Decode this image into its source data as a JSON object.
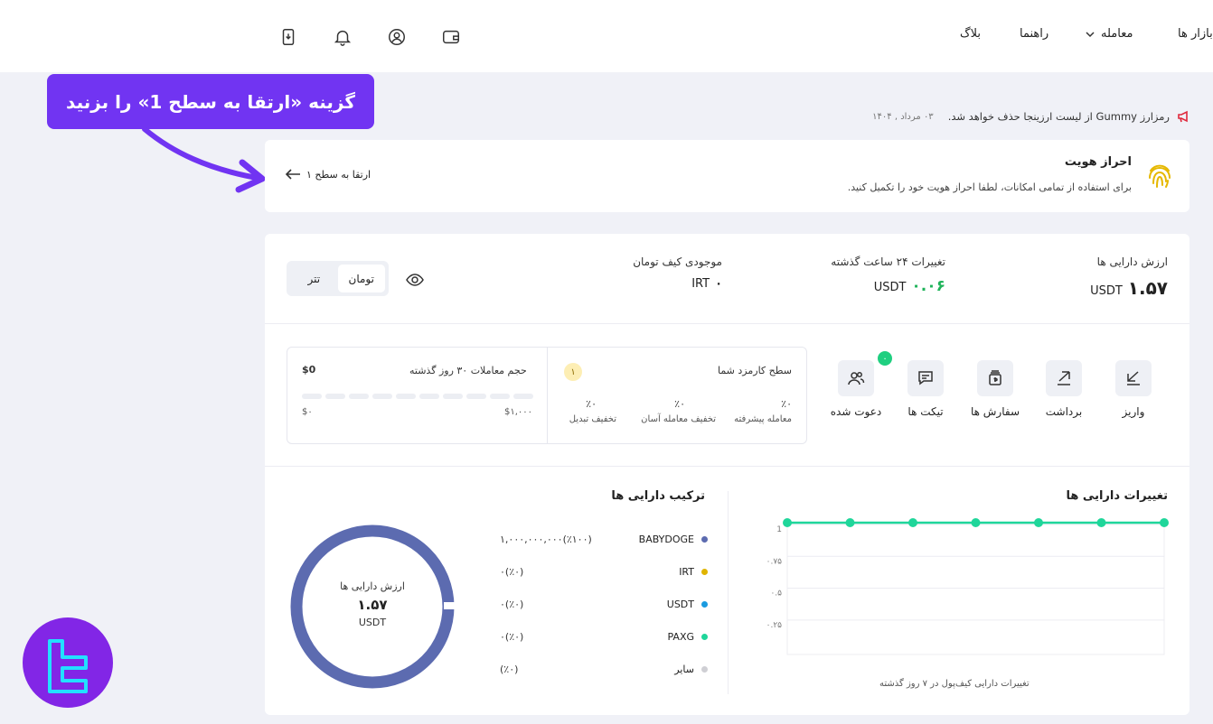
{
  "nav": {
    "markets": "بازار ها",
    "trade": "معامله",
    "guide": "راهنما",
    "blog": "بلاگ"
  },
  "announcement": {
    "text": "رمزارز Gummy از لیست ارزینجا حذف خواهد شد.",
    "date": "۰۳ مرداد , ۱۴۰۴"
  },
  "callout": {
    "text": "گزینه «ارتقا به سطح 1» را بزنید"
  },
  "kyc": {
    "title": "احراز هویت",
    "description": "برای استفاده از تمامی امکانات، لطفا احراز هویت خود را تکمیل کنید.",
    "upgrade_label": "ارتقا به سطح ۱"
  },
  "summary": {
    "asset_value_label": "ارزش دارایی ها",
    "asset_value": "۱.۵۷",
    "asset_unit": "USDT",
    "change_label": "تغییرات ۲۴ ساعت گذشته",
    "change_value": "۰.۰۶",
    "change_unit": "USDT",
    "wallet_label": "موجودی کیف تومان",
    "wallet_value": "۰",
    "wallet_unit": "IRT",
    "toggle_toman": "تومان",
    "toggle_tether": "تتر"
  },
  "quick_actions": {
    "deposit": "واریز",
    "withdraw": "برداشت",
    "orders": "سفارش ها",
    "tickets": "تیکت ها",
    "invited": "دعوت شده",
    "invited_count": "۰"
  },
  "fee": {
    "level_label": "سطح کارمزد شما",
    "level": "۱",
    "advanced_pct": "٪۰",
    "advanced_label": "معامله پیشرفته",
    "easy_pct": "٪۰",
    "easy_label": "تخفیف معامله آسان",
    "convert_pct": "٪۰",
    "convert_label": "تخفیف تبدیل",
    "volume_label": "حجم معاملات ۳۰ روز گذشته",
    "volume_value": "$0",
    "volume_max": "$۱,۰۰۰",
    "volume_min": "$۰",
    "volume_progress": 0
  },
  "asset_changes": {
    "title": "تغییرات دارایی ها",
    "caption": "تغییرات دارایی کیف‌پول در ۷ روز گذشته",
    "y_ticks": [
      "1",
      "۰.۷۵",
      "۰.۵",
      "۰.۲۵"
    ],
    "values": [
      1,
      1,
      1,
      1,
      1,
      1,
      1
    ],
    "color": "#1fd69a"
  },
  "composition": {
    "title": "ترکیب دارایی ها",
    "donut_label": "ارزش دارایی ها",
    "donut_value": "۱.۵۷",
    "donut_unit": "USDT",
    "donut_color": "#5c6bb0",
    "items": [
      {
        "name": "BABYDOGE",
        "value": "۱,۰۰۰,۰۰۰,۰۰۰(٪۱۰۰)",
        "color": "#5c6bb0"
      },
      {
        "name": "IRT",
        "value": "۰(٪۰)",
        "color": "#e0b400"
      },
      {
        "name": "USDT",
        "value": "۰(٪۰)",
        "color": "#1a9be0"
      },
      {
        "name": "PAXG",
        "value": "۰(٪۰)",
        "color": "#1fd69a"
      },
      {
        "name": "سایر",
        "value": "(٪۰)",
        "color": "#cfcfd4"
      }
    ]
  }
}
